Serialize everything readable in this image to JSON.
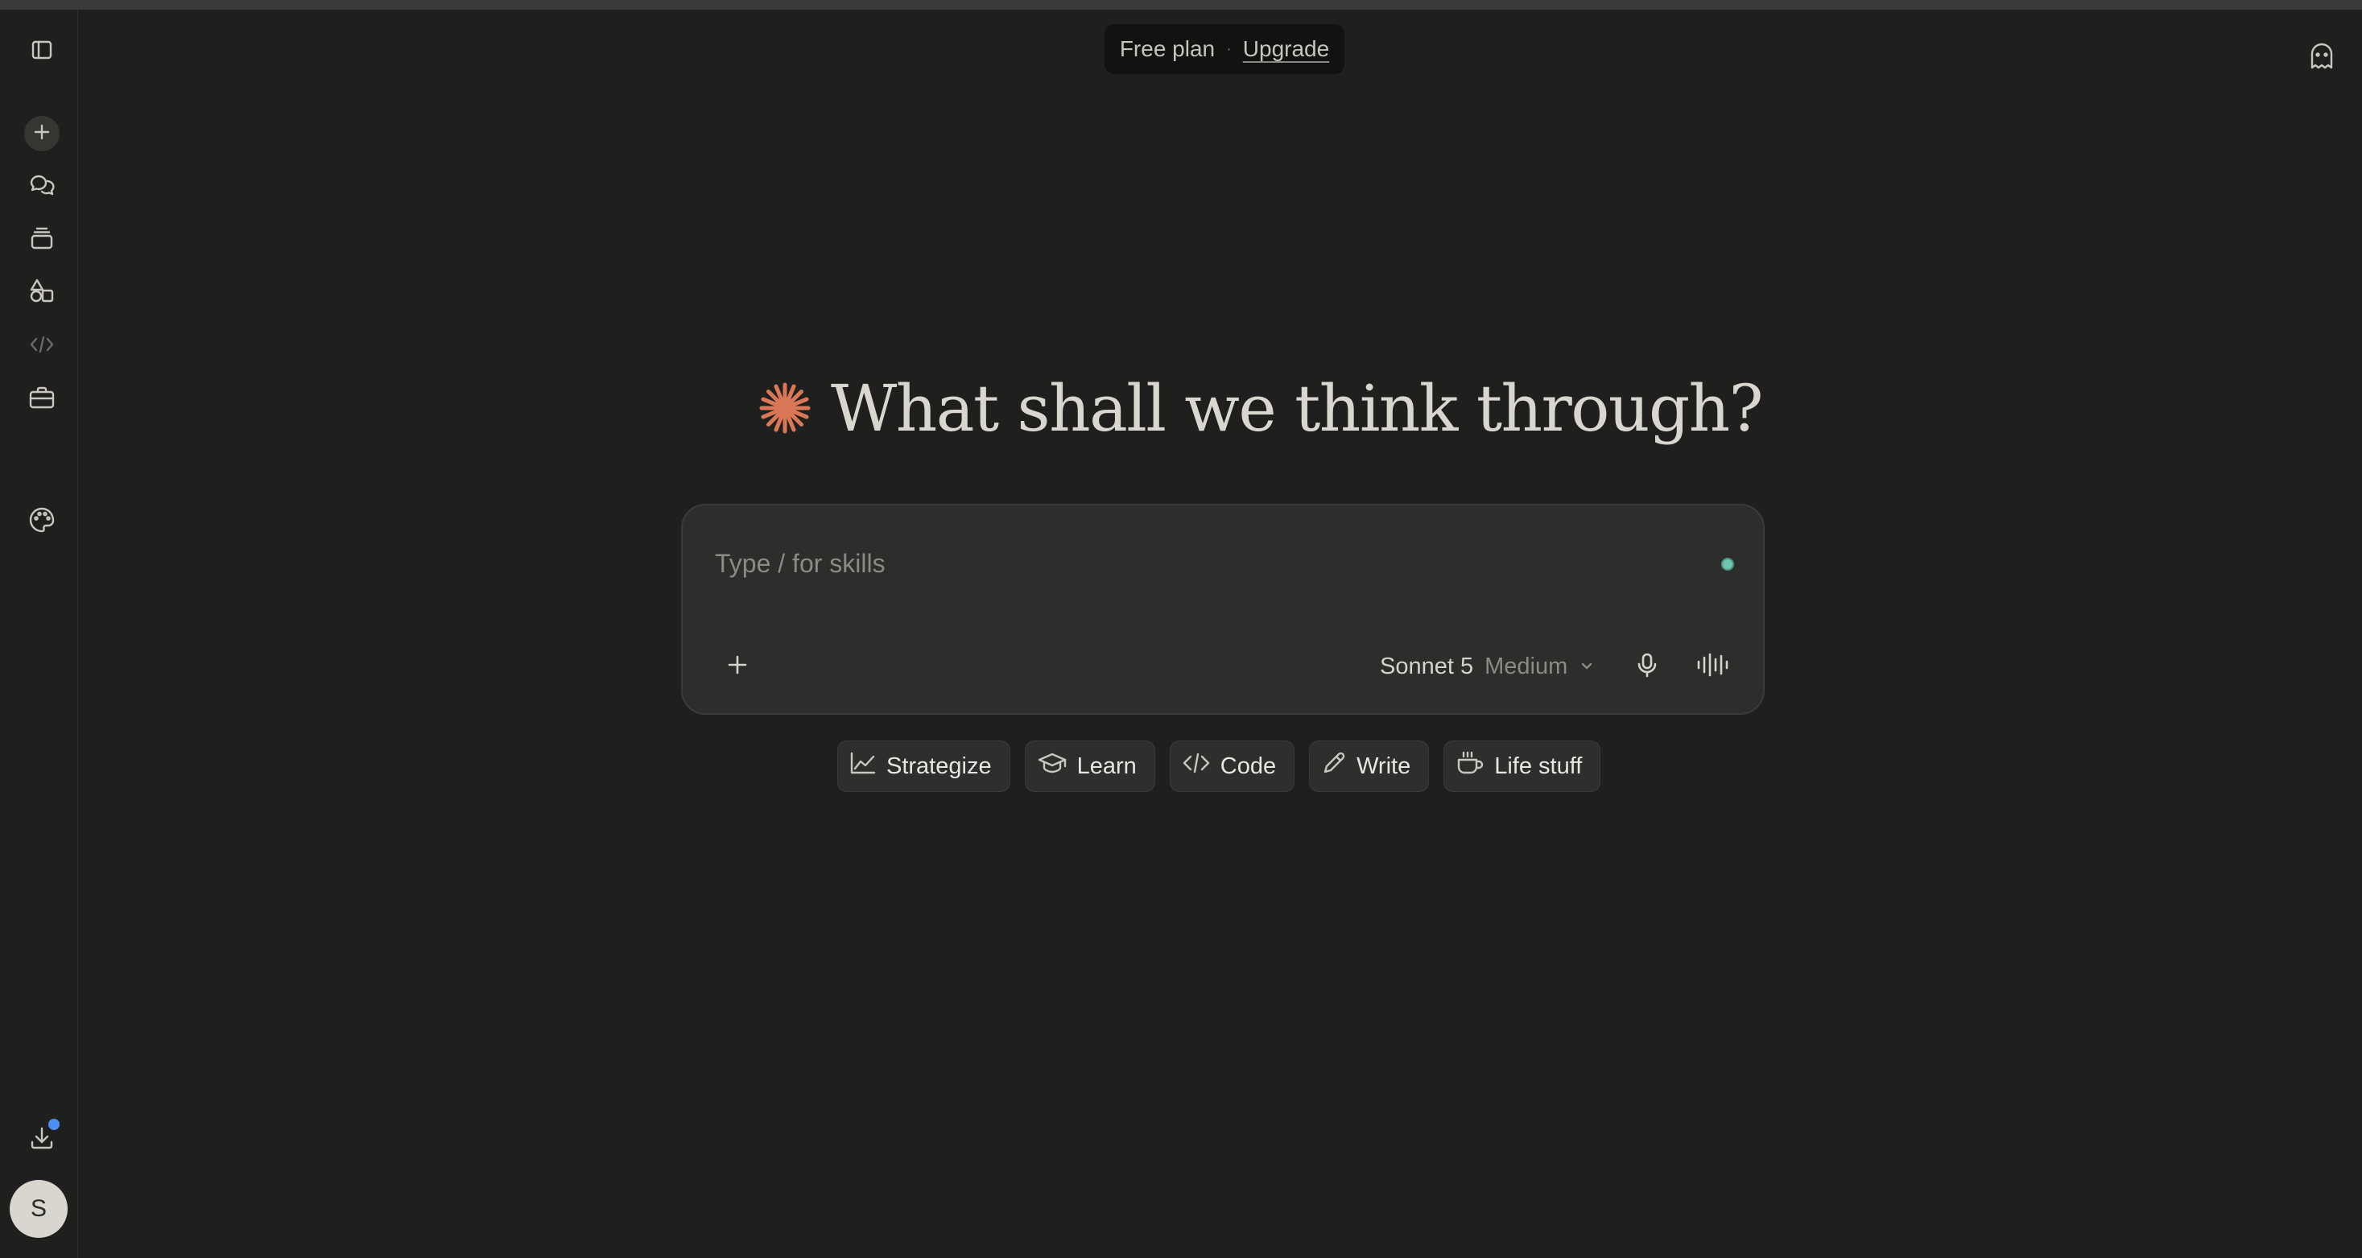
{
  "plan": {
    "label": "Free plan",
    "separator": "·",
    "upgrade_label": "Upgrade"
  },
  "sidebar": {
    "items": [
      {
        "name": "toggle-sidebar",
        "icon": "sidebar-toggle-icon"
      },
      {
        "name": "new-chat",
        "icon": "plus-icon"
      },
      {
        "name": "chats",
        "icon": "chat-bubbles-icon"
      },
      {
        "name": "projects",
        "icon": "stack-icon"
      },
      {
        "name": "artifacts",
        "icon": "shapes-icon"
      },
      {
        "name": "code",
        "icon": "code-icon"
      },
      {
        "name": "tools",
        "icon": "briefcase-icon"
      },
      {
        "name": "customize",
        "icon": "palette-icon"
      },
      {
        "name": "download-app",
        "icon": "download-icon",
        "has_notification": true
      }
    ],
    "user_initial": "S"
  },
  "headline": {
    "text": "What shall we think through?",
    "accent_color": "#d97757"
  },
  "composer": {
    "placeholder": "Type / for skills",
    "value": "",
    "model": "Sonnet 5",
    "effort": "Medium"
  },
  "chips": [
    {
      "label": "Strategize",
      "icon": "chart-line-icon"
    },
    {
      "label": "Learn",
      "icon": "graduation-cap-icon"
    },
    {
      "label": "Code",
      "icon": "code-icon"
    },
    {
      "label": "Write",
      "icon": "pencil-icon"
    },
    {
      "label": "Life stuff",
      "icon": "coffee-cup-icon"
    }
  ],
  "colors": {
    "background": "#1f1f1e",
    "composer_bg": "#2d2d2b",
    "status_dot": "#6fc7b0",
    "notification_dot": "#4e8ef0"
  }
}
